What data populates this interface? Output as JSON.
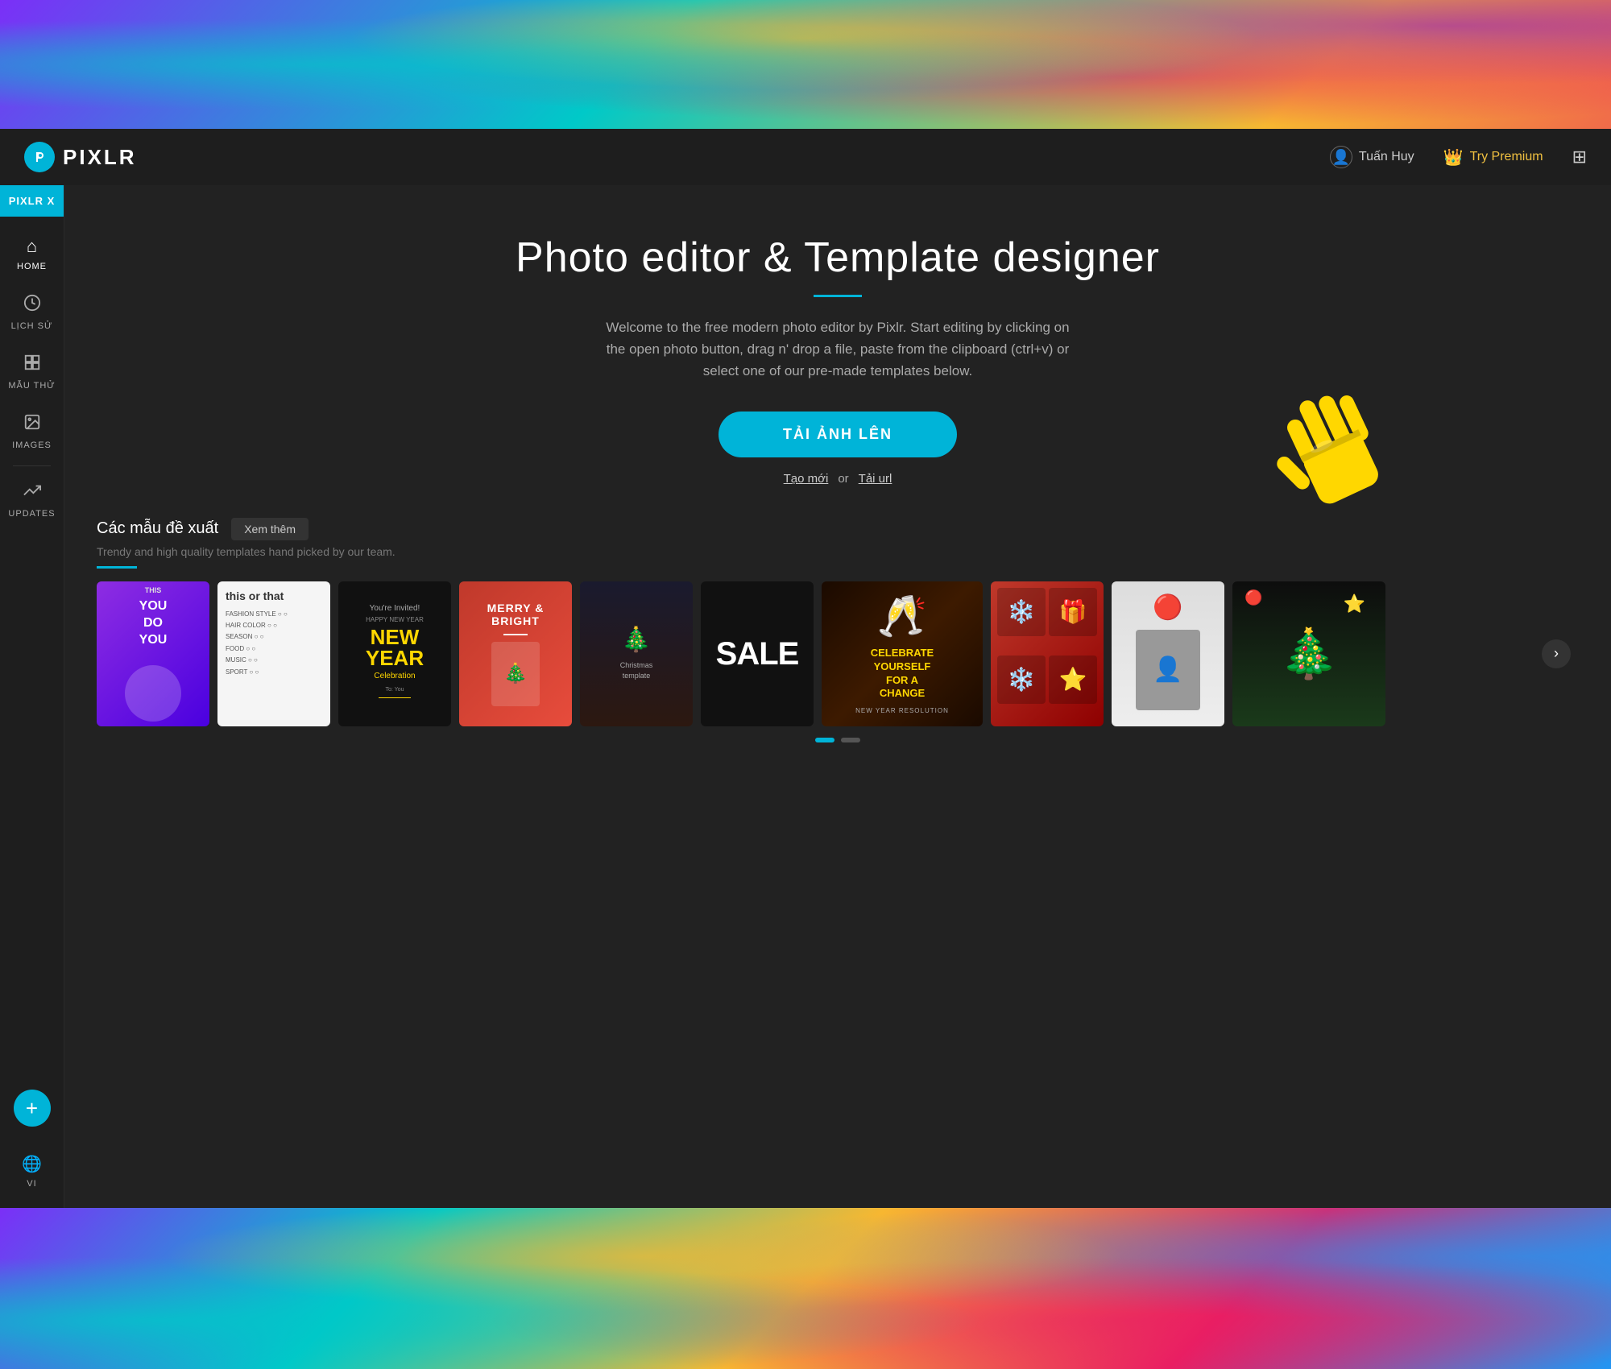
{
  "app": {
    "name": "PIXLR",
    "logo_letter": "P",
    "tab_name": "PIXLR X"
  },
  "navbar": {
    "user_name": "Tuấn Huy",
    "try_premium_label": "Try Premium"
  },
  "sidebar": {
    "items": [
      {
        "id": "home",
        "label": "HOME",
        "icon": "⌂"
      },
      {
        "id": "history",
        "label": "LỊCH SỬ",
        "icon": "🕐"
      },
      {
        "id": "templates",
        "label": "MẪU THỬ",
        "icon": "⊞"
      },
      {
        "id": "images",
        "label": "IMAGES",
        "icon": "🖼"
      },
      {
        "id": "updates",
        "label": "UPDATES",
        "icon": "↑"
      }
    ],
    "add_button_label": "+",
    "lang_label": "VI"
  },
  "hero": {
    "title": "Photo editor & Template designer",
    "subtitle": "Welcome to the free modern photo editor by Pixlr. Start editing by clicking on the open photo button, drag n' drop a file, paste from the clipboard (ctrl+v) or select one of our pre-made templates below.",
    "upload_button": "TẢI ẢNH LÊN",
    "action_create": "Tạo mới",
    "action_or": "or",
    "action_url": "Tải url"
  },
  "templates_section": {
    "title": "Các mẫu đề xuất",
    "see_more_label": "Xem thêm",
    "subtitle": "Trendy and high quality templates hand picked by our team.",
    "nav_arrow": "›",
    "pagination": {
      "total": 2,
      "active": 0
    }
  },
  "colors": {
    "primary": "#00b4d8",
    "background": "#222222",
    "sidebar_bg": "#1e1e1e",
    "text_primary": "#ffffff",
    "text_secondary": "#aaaaaa",
    "accent_gold": "#f0c040"
  }
}
